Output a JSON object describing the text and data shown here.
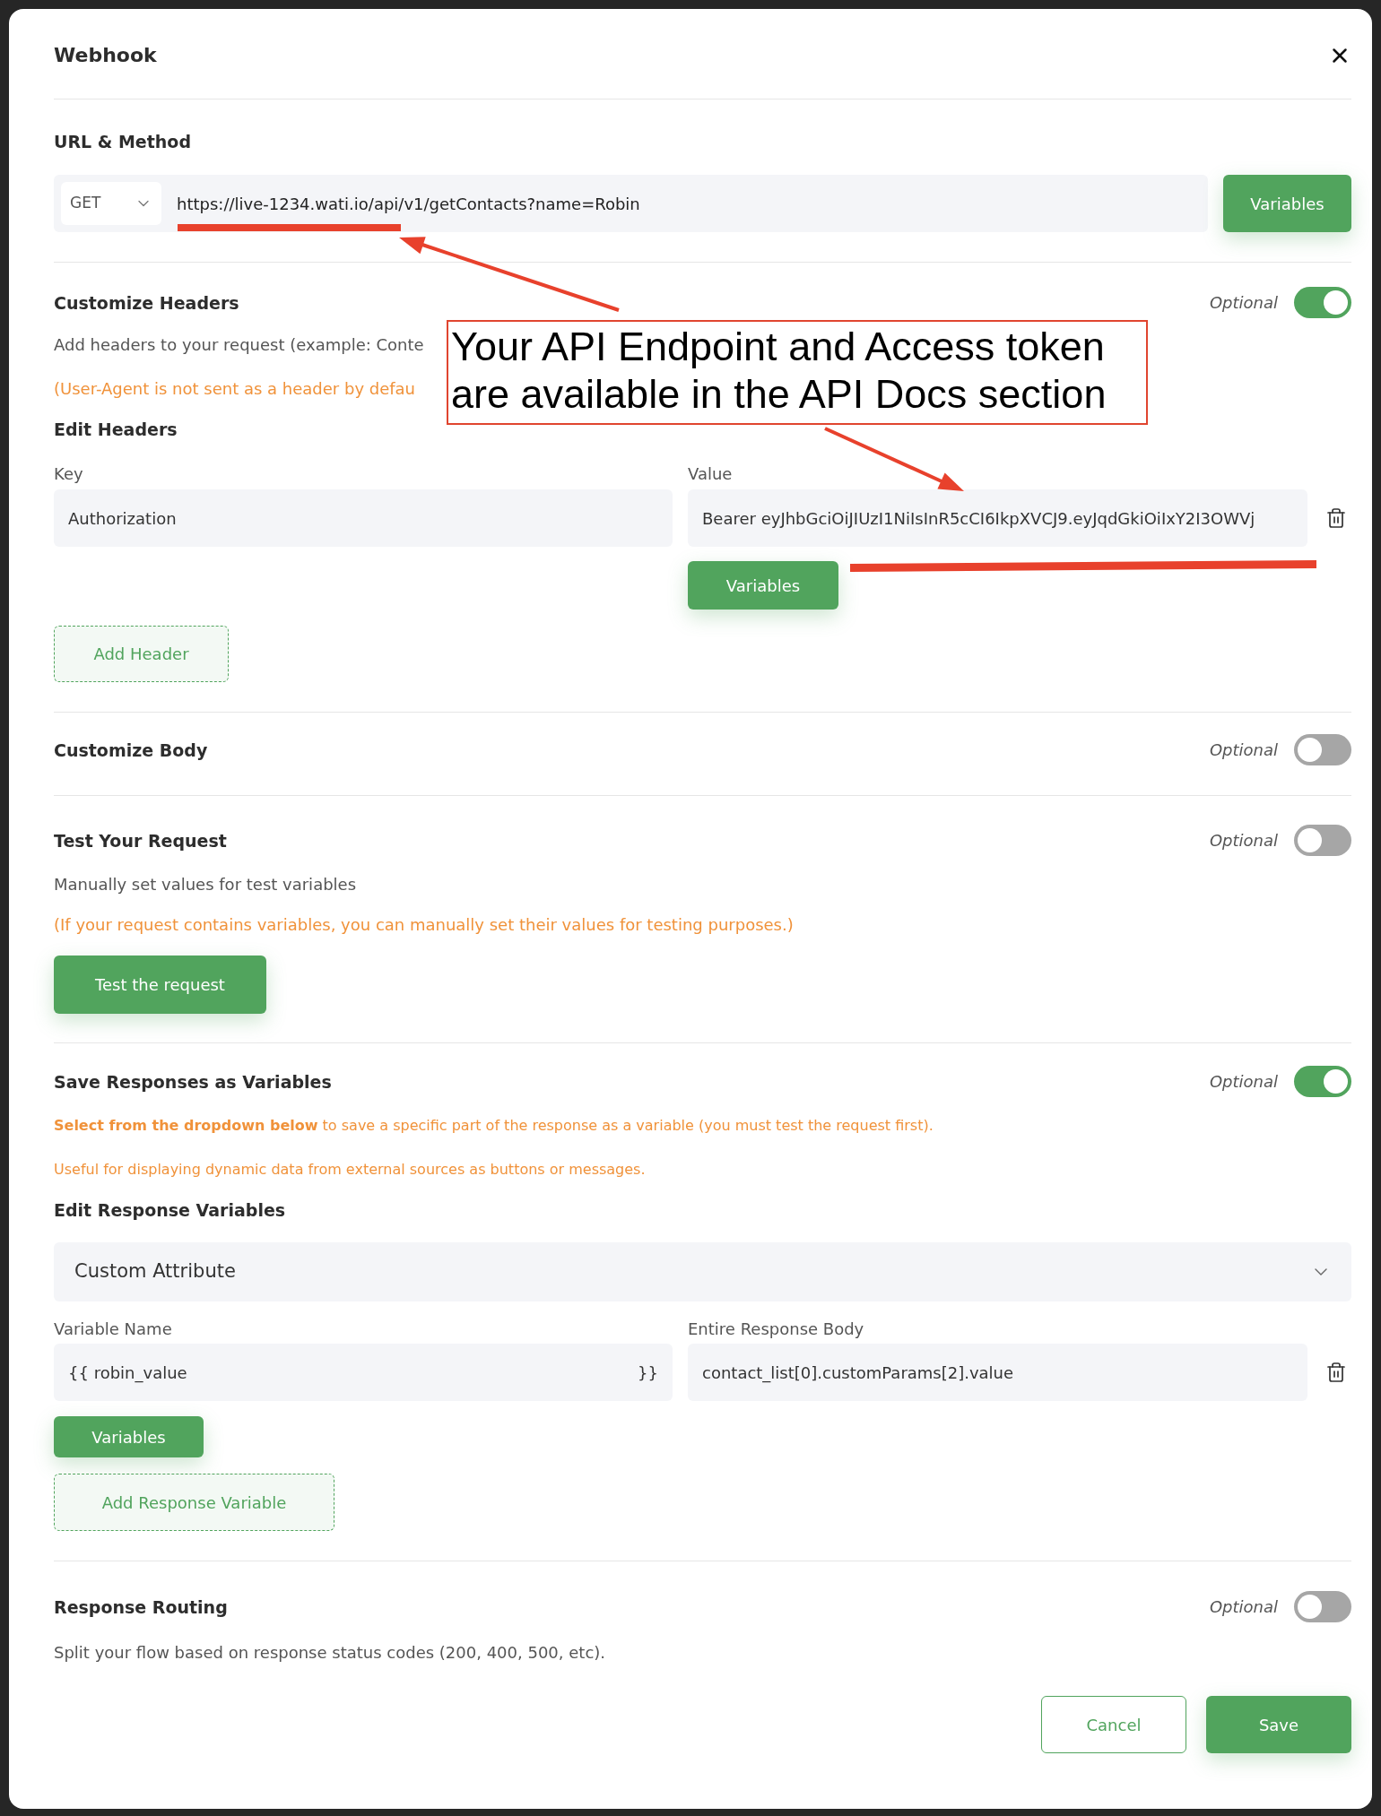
{
  "modal": {
    "title": "Webhook"
  },
  "url_method": {
    "heading": "URL & Method",
    "method": "GET",
    "url": "https://live-1234.wati.io/api/v1/getContacts?name=Robin",
    "variables_button": "Variables"
  },
  "customize_headers": {
    "heading": "Customize Headers",
    "optional_label": "Optional",
    "on": true,
    "description": "Add headers to your request (example: Conte",
    "note": "(User-Agent is not sent as a header by defau",
    "edit_heading": "Edit Headers",
    "key_label": "Key",
    "value_label": "Value",
    "rows": [
      {
        "key": "Authorization",
        "value": "Bearer eyJhbGciOiJIUzI1NiIsInR5cCI6IkpXVCJ9.eyJqdGkiOiIxY2I3OWVj"
      }
    ],
    "variables_button": "Variables",
    "add_button": "Add Header"
  },
  "customize_body": {
    "heading": "Customize Body",
    "optional_label": "Optional",
    "on": false
  },
  "test_request": {
    "heading": "Test Your Request",
    "optional_label": "Optional",
    "on": false,
    "description": "Manually set values for test variables",
    "note": "(If your request contains variables, you can manually set their values for testing purposes.)",
    "button": "Test the request"
  },
  "save_responses": {
    "heading": "Save Responses as Variables",
    "optional_label": "Optional",
    "on": true,
    "notes": [
      "**Select from the dropdown below** to save a specific part of the response as a variable (you must test the request first).",
      "Useful for displaying dynamic data from external sources as buttons or messages."
    ],
    "edit_heading": "Edit Response Variables",
    "dropdown": "Custom Attribute",
    "name_label": "Variable Name",
    "body_label": "Entire Response Body",
    "rows": [
      {
        "prefix": "{{",
        "name": "robin_value",
        "suffix": "}}",
        "path": "contact_list[0].customParams[2].value"
      }
    ],
    "variables_button": "Variables",
    "add_button": "Add Response Variable"
  },
  "response_routing": {
    "heading": "Response Routing",
    "optional_label": "Optional",
    "on": false,
    "description": "Split your flow based on response status codes (200, 400, 500, etc)."
  },
  "footer": {
    "cancel_button": "Cancel",
    "save_button": "Save"
  },
  "annotation": {
    "text": "Your API Endpoint and Access token are available in the API Docs section"
  }
}
